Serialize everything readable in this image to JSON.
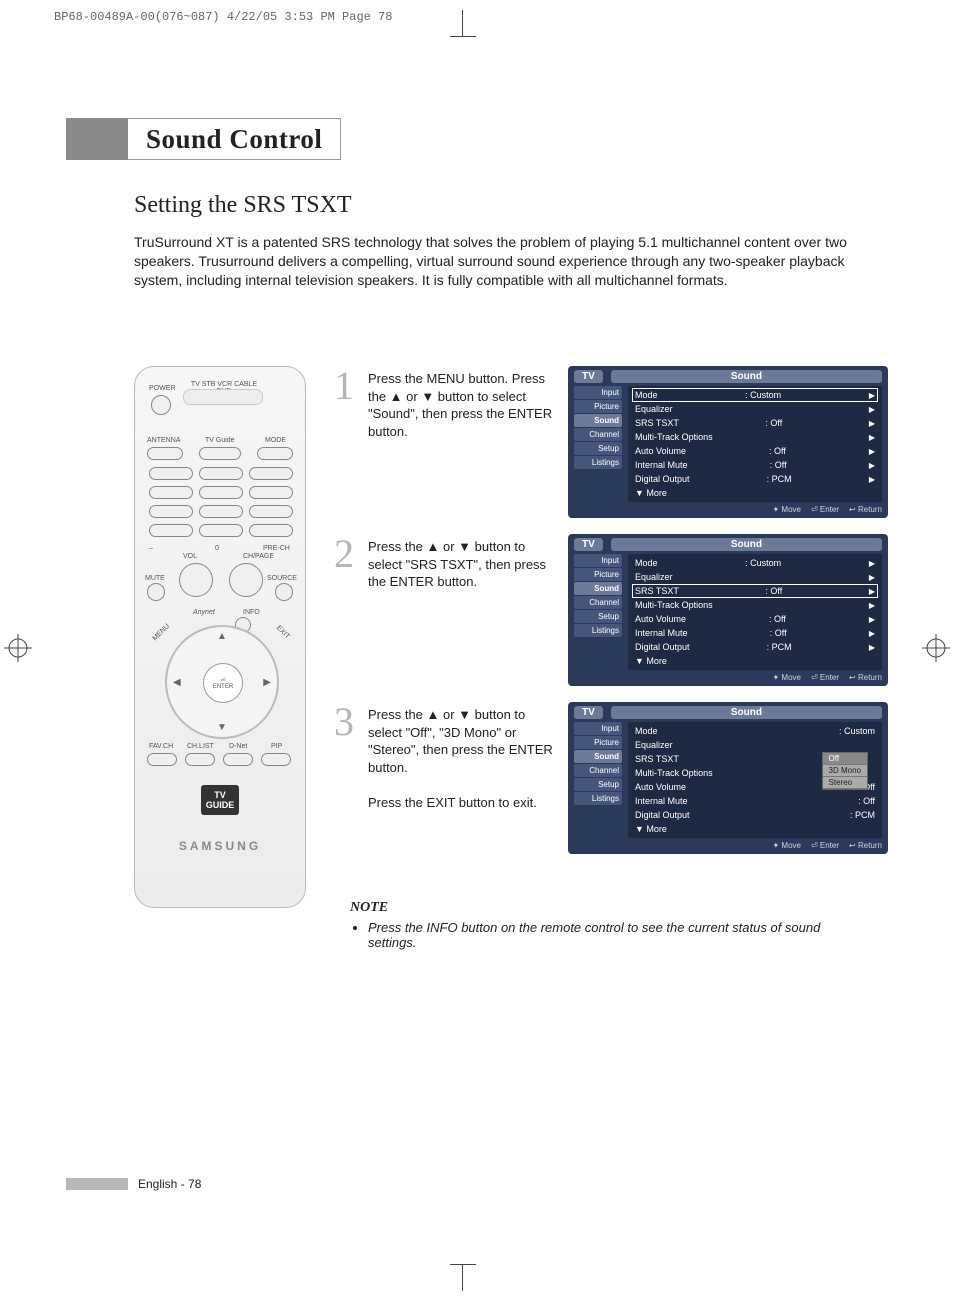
{
  "slug": "BP68-00489A-00(076~087)  4/22/05  3:53 PM  Page 78",
  "chapter": "Sound Control",
  "heading": "Setting the SRS TSXT",
  "intro": "TruSurround XT is a patented SRS technology that solves the problem of playing 5.1 multichannel content over two speakers. Trusurround delivers a compelling, virtual surround sound experience through any two-speaker playback system, including internal television speakers. It is fully compatible with all multichannel formats.",
  "steps": [
    {
      "n": "1",
      "text": "Press the MENU button. Press the ▲ or ▼ button to select \"Sound\", then press the ENTER button."
    },
    {
      "n": "2",
      "text": "Press the ▲ or ▼ button to select \"SRS TSXT\", then press the ENTER button."
    },
    {
      "n": "3",
      "text": "Press the ▲ or ▼ button to select \"Off\", \"3D Mono\" or \"Stereo\", then press the ENTER button.",
      "text2": "Press the EXIT button to exit."
    }
  ],
  "osd": {
    "tv": "TV",
    "title": "Sound",
    "nav": [
      "Input",
      "Picture",
      "Sound",
      "Channel",
      "Setup",
      "Listings"
    ],
    "nav_sel": "Sound",
    "rows": [
      {
        "label": "Mode",
        "value": ": Custom"
      },
      {
        "label": "Equalizer",
        "value": ""
      },
      {
        "label": "SRS TSXT",
        "value": ": Off"
      },
      {
        "label": "Multi-Track Options",
        "value": ""
      },
      {
        "label": "Auto Volume",
        "value": ": Off"
      },
      {
        "label": "Internal Mute",
        "value": ": Off"
      },
      {
        "label": "Digital Output",
        "value": ": PCM"
      },
      {
        "label": "▼ More",
        "value": ""
      }
    ],
    "foot": {
      "move": "Move",
      "enter": "Enter",
      "return": "Return"
    },
    "srs_options": [
      "Off",
      "3D Mono",
      "Stereo"
    ]
  },
  "remote": {
    "power": "POWER",
    "top_labels": "TV  STB  VCR  CABLE  DVD",
    "row2": [
      "ANTENNA",
      "TV Guide",
      "MODE"
    ],
    "bottom_row": [
      "FAV.CH",
      "CH.LIST",
      "D-Net",
      "PIP"
    ],
    "mid_left": "MUTE",
    "mid_right": "SOURCE",
    "vol": "VOL",
    "chpage": "CH/PAGE",
    "minus": "–",
    "zero": "0",
    "prech": "PRE-CH",
    "enter": "ENTER",
    "brand": "SAMSUNG",
    "tvguide1": "TV",
    "tvguide2": "GUIDE",
    "info": "INFO",
    "anynet": "Anynet",
    "menu": "MENU",
    "exit": "EXIT"
  },
  "note": {
    "heading": "NOTE",
    "item": "Press the INFO button on the remote control to see the current status of sound settings."
  },
  "footer": "English - 78"
}
